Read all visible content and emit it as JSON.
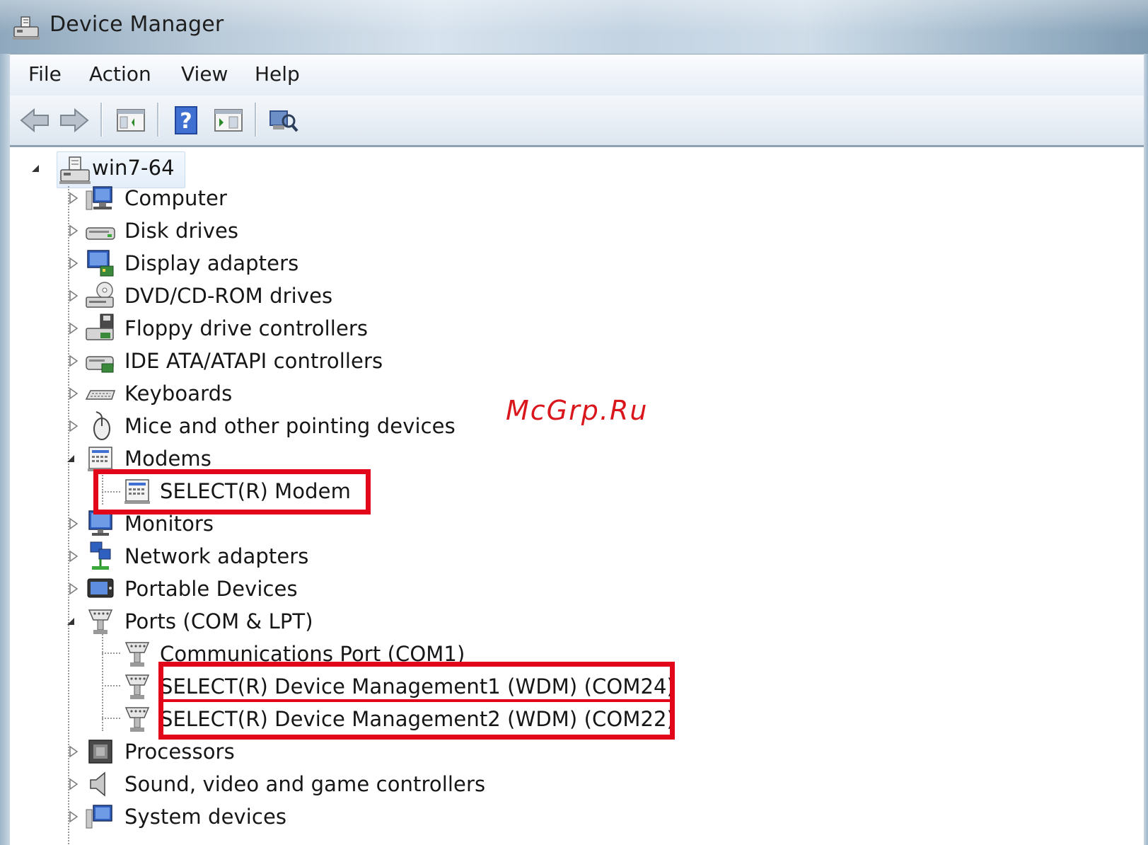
{
  "window": {
    "title": "Device Manager"
  },
  "menu": [
    "File",
    "Action",
    "View",
    "Help"
  ],
  "toolbar": {
    "buttons": [
      "back-arrow-icon",
      "forward-arrow-icon",
      "show-hide-console-tree-icon",
      "help-icon",
      "properties-pane-icon",
      "scan-hardware-icon"
    ]
  },
  "tree": {
    "root": {
      "label": "win7-64",
      "icon": "computer-icon",
      "expanded": true
    },
    "nodes": [
      {
        "label": "Computer",
        "icon": "computer-icon",
        "expanded": false,
        "children": []
      },
      {
        "label": "Disk drives",
        "icon": "disk-drive-icon",
        "expanded": false,
        "children": []
      },
      {
        "label": "Display adapters",
        "icon": "display-adapter-icon",
        "expanded": false,
        "children": []
      },
      {
        "label": "DVD/CD-ROM drives",
        "icon": "dvd-drive-icon",
        "expanded": false,
        "children": []
      },
      {
        "label": "Floppy drive controllers",
        "icon": "floppy-controller-icon",
        "expanded": false,
        "children": []
      },
      {
        "label": "IDE ATA/ATAPI controllers",
        "icon": "ide-controller-icon",
        "expanded": false,
        "children": []
      },
      {
        "label": "Keyboards",
        "icon": "keyboard-icon",
        "expanded": false,
        "children": []
      },
      {
        "label": "Mice and other pointing devices",
        "icon": "mouse-icon",
        "expanded": false,
        "children": []
      },
      {
        "label": "Modems",
        "icon": "modem-icon",
        "expanded": true,
        "children": [
          {
            "label": "SELECT(R) Modem",
            "icon": "modem-icon",
            "highlighted": true
          }
        ]
      },
      {
        "label": "Monitors",
        "icon": "monitor-icon",
        "expanded": false,
        "children": []
      },
      {
        "label": "Network adapters",
        "icon": "network-adapter-icon",
        "expanded": false,
        "children": []
      },
      {
        "label": "Portable Devices",
        "icon": "portable-device-icon",
        "expanded": false,
        "children": []
      },
      {
        "label": "Ports (COM & LPT)",
        "icon": "port-icon",
        "expanded": true,
        "children": [
          {
            "label": "Communications Port (COM1)",
            "icon": "port-icon",
            "highlighted": false
          },
          {
            "label": "SELECT(R) Device Management1 (WDM) (COM24)",
            "icon": "port-icon",
            "highlighted": true
          },
          {
            "label": "SELECT(R) Device Management2 (WDM) (COM22)",
            "icon": "port-icon",
            "highlighted": true
          }
        ]
      },
      {
        "label": "Processors",
        "icon": "processor-icon",
        "expanded": false,
        "children": []
      },
      {
        "label": "Sound, video and game controllers",
        "icon": "sound-icon",
        "expanded": false,
        "children": []
      },
      {
        "label": "System devices",
        "icon": "system-device-icon",
        "expanded": false,
        "children": []
      }
    ]
  },
  "watermark": "McGrp.Ru",
  "colors": {
    "highlight_box": "#e2061b",
    "watermark": "#d9161c",
    "selection": "#e4eefa"
  }
}
